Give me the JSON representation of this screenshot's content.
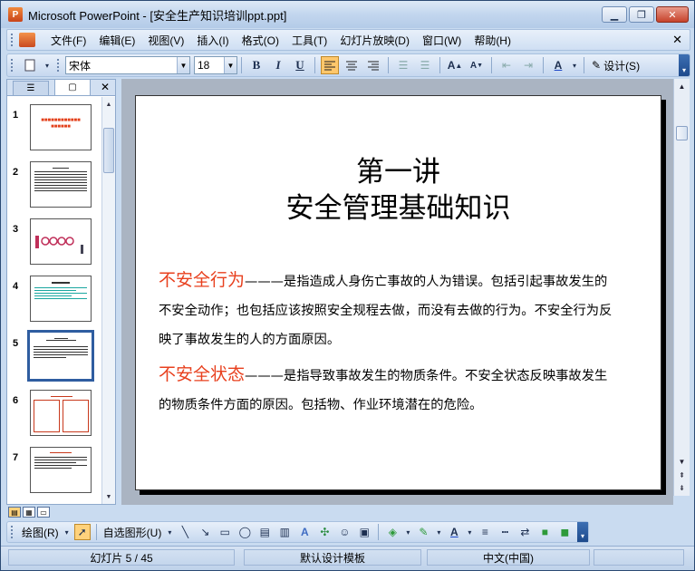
{
  "window": {
    "title": "Microsoft PowerPoint - [安全生产知识培训ppt.ppt]",
    "minimize": "▁",
    "restore": "❐",
    "close": "✕"
  },
  "menu": {
    "items": [
      "文件(F)",
      "编辑(E)",
      "视图(V)",
      "插入(I)",
      "格式(O)",
      "工具(T)",
      "幻灯片放映(D)",
      "窗口(W)",
      "帮助(H)"
    ],
    "close_doc": "✕"
  },
  "toolbar": {
    "font_name": "宋体",
    "font_size": "18",
    "bold": "B",
    "italic": "I",
    "underline": "U",
    "design_label": "设计(S)"
  },
  "left_pane": {
    "slide_numbers": [
      "1",
      "2",
      "3",
      "4",
      "5",
      "6",
      "7"
    ],
    "selected_slide": "5",
    "close": "✕"
  },
  "slide": {
    "title_line1": "第一讲",
    "title_line2": "安全管理基础知识",
    "para1_term": "不安全行为",
    "para1_text": "———是指造成人身伤亡事故的人为错误。包括引起事故发生的不安全动作；也包括应该按照安全规程去做，而没有去做的行为。不安全行为反映了事故发生的人的方面原因。",
    "para2_term": "不安全状态",
    "para2_text": "———是指导致事故发生的物质条件。不安全状态反映事故发生的物质条件方面的原因。包括物、作业环境潜在的危险。"
  },
  "drawbar": {
    "draw_label": "绘图(R)",
    "autoshapes_label": "自选图形(U)"
  },
  "status": {
    "slide_pos": "幻灯片 5 / 45",
    "template": "默认设计模板",
    "language": "中文(中国)"
  },
  "colors": {
    "accent_red": "#e8401e",
    "selection_blue": "#2f5da0"
  }
}
